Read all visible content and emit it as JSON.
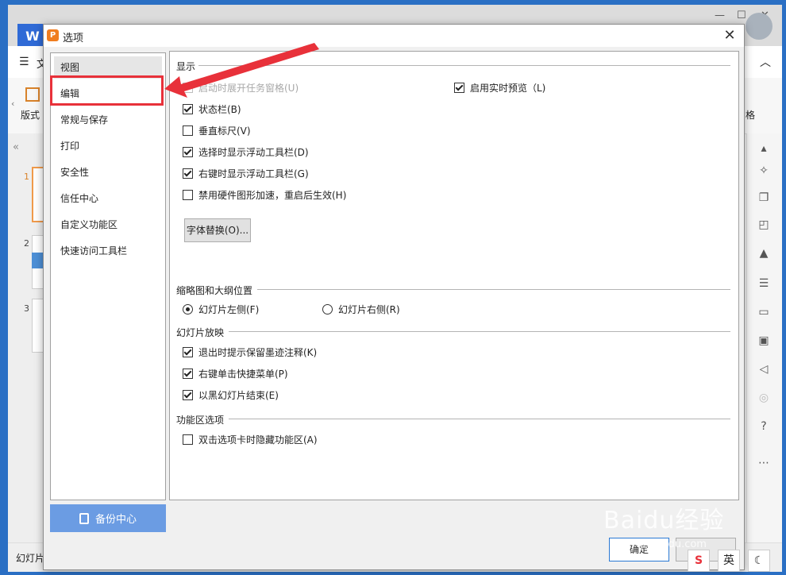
{
  "background": {
    "logo": "W",
    "toolbar_menu_label": "文",
    "ribbon_left_label": "版式",
    "ribbon_right_label": "格",
    "slide_numbers": [
      "1",
      "2",
      "3"
    ],
    "status_label": "幻灯片"
  },
  "dialog": {
    "title": "选项",
    "nav": {
      "items": [
        {
          "label": "视图"
        },
        {
          "label": "编辑"
        },
        {
          "label": "常规与保存"
        },
        {
          "label": "打印"
        },
        {
          "label": "安全性"
        },
        {
          "label": "信任中心"
        },
        {
          "label": "自定义功能区"
        },
        {
          "label": "快速访问工具栏"
        }
      ],
      "selected": "视图",
      "highlighted": "编辑"
    },
    "backup_center_label": "备份中心",
    "sections": {
      "display": {
        "title": "显示",
        "options": [
          {
            "label": "启动时展开任务窗格(U)",
            "checked": false,
            "disabled": true
          },
          {
            "label": "状态栏(B)",
            "checked": true
          },
          {
            "label": "垂直标尺(V)",
            "checked": false
          },
          {
            "label": "选择时显示浮动工具栏(D)",
            "checked": true
          },
          {
            "label": "右键时显示浮动工具栏(G)",
            "checked": true
          },
          {
            "label": "禁用硬件图形加速，重启后生效(H)",
            "checked": false
          }
        ],
        "right_option": {
          "label": "启用实时预览（L)",
          "checked": true
        },
        "font_replace_button": "字体替换(O)..."
      },
      "thumbnail": {
        "title": "缩略图和大纲位置",
        "radios": [
          {
            "label": "幻灯片左侧(F)",
            "checked": true
          },
          {
            "label": "幻灯片右侧(R)",
            "checked": false
          }
        ]
      },
      "slideshow": {
        "title": "幻灯片放映",
        "options": [
          {
            "label": "退出时提示保留墨迹注释(K)",
            "checked": true
          },
          {
            "label": "右键单击快捷菜单(P)",
            "checked": true
          },
          {
            "label": "以黑幻灯片结束(E)",
            "checked": true
          }
        ]
      },
      "ribbon": {
        "title": "功能区选项",
        "options": [
          {
            "label": "双击选项卡时隐藏功能区(A)",
            "checked": false
          }
        ]
      }
    },
    "ok_label": "确定"
  },
  "overlay": {
    "annotation_color": "#e8313a",
    "watermark": "Baidu经验",
    "watermark_url": "jingyan.baidu.com"
  },
  "taskbar": {
    "ime_label": "英"
  }
}
